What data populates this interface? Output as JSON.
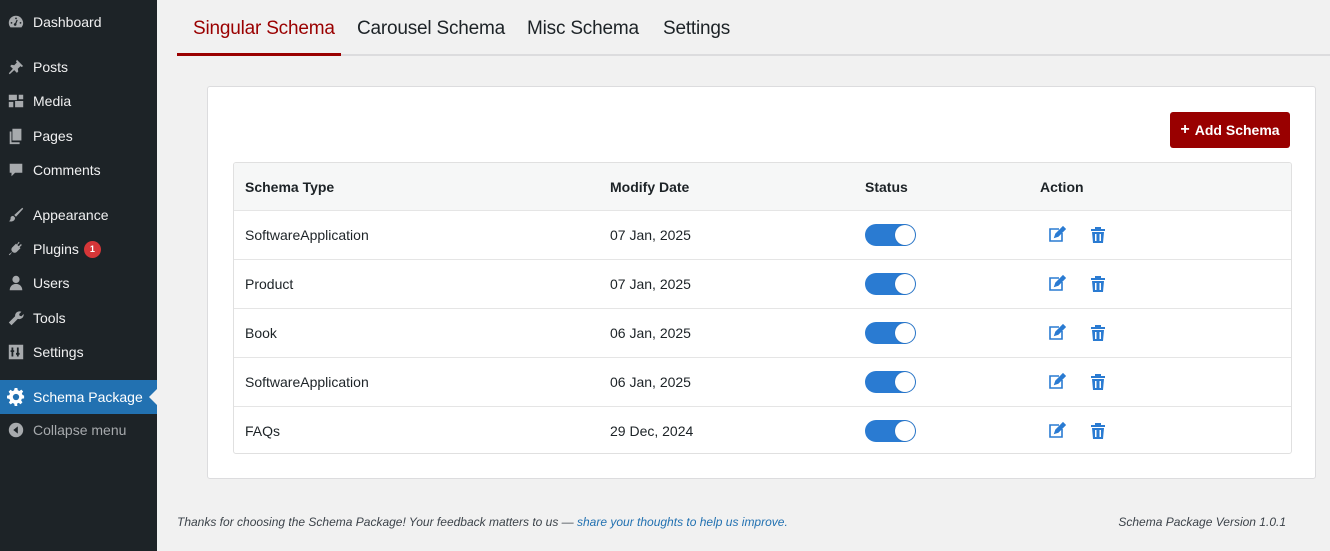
{
  "sidebar": {
    "items": [
      {
        "label": "Dashboard",
        "icon": "dashboard-icon"
      },
      {
        "label": "Posts",
        "icon": "pin-icon"
      },
      {
        "label": "Media",
        "icon": "media-icon"
      },
      {
        "label": "Pages",
        "icon": "pages-icon"
      },
      {
        "label": "Comments",
        "icon": "comment-icon"
      },
      {
        "label": "Appearance",
        "icon": "brush-icon"
      },
      {
        "label": "Plugins",
        "icon": "plug-icon",
        "badge": "1"
      },
      {
        "label": "Users",
        "icon": "user-icon"
      },
      {
        "label": "Tools",
        "icon": "wrench-icon"
      },
      {
        "label": "Settings",
        "icon": "sliders-icon"
      },
      {
        "label": "Schema Package",
        "icon": "gear-icon",
        "active": true
      },
      {
        "label": "Collapse menu",
        "icon": "collapse-icon"
      }
    ]
  },
  "tabs": [
    {
      "label": "Singular Schema",
      "active": true
    },
    {
      "label": "Carousel Schema"
    },
    {
      "label": "Misc Schema"
    },
    {
      "label": "Settings"
    }
  ],
  "toolbar": {
    "add_label": "Add Schema"
  },
  "table": {
    "headers": [
      "Schema Type",
      "Modify Date",
      "Status",
      "Action"
    ],
    "rows": [
      {
        "type": "SoftwareApplication",
        "date": "07 Jan, 2025",
        "status": true
      },
      {
        "type": "Product",
        "date": "07 Jan, 2025",
        "status": true
      },
      {
        "type": "Book",
        "date": "06 Jan, 2025",
        "status": true
      },
      {
        "type": "SoftwareApplication",
        "date": "06 Jan, 2025",
        "status": true
      },
      {
        "type": "FAQs",
        "date": "29 Dec, 2024",
        "status": true
      }
    ]
  },
  "footer": {
    "thanks": "Thanks for choosing the Schema Package! Your feedback matters to us — ",
    "link": "share your thoughts to help us improve.",
    "version": "Schema Package Version 1.0.1"
  },
  "colors": {
    "accent": "#990000",
    "sidebar_bg": "#1d2327",
    "active_menu": "#2271b1",
    "toggle_on": "#2a7bd2",
    "action_icon": "#2a7bd2"
  }
}
